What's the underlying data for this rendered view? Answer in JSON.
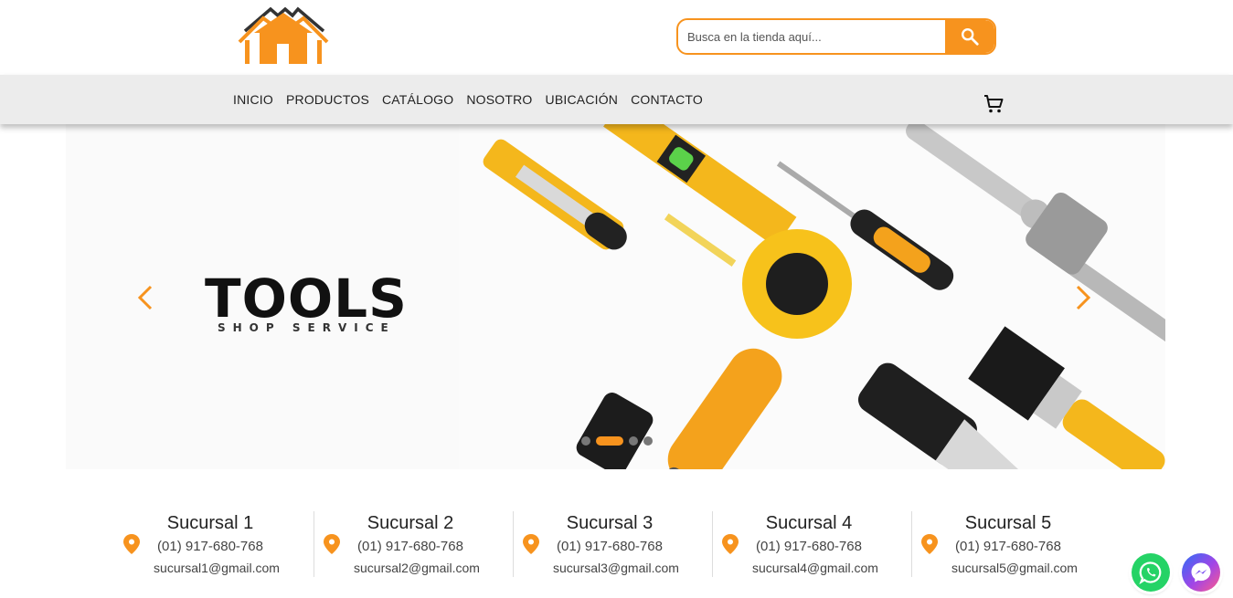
{
  "header": {
    "logo_icon": "house-logo-icon",
    "search": {
      "placeholder": "Busca en la tienda aquí...",
      "icon": "search-icon"
    }
  },
  "nav": {
    "items": [
      {
        "label": "INICIO"
      },
      {
        "label": "PRODUCTOS"
      },
      {
        "label": "CATÁLOGO"
      },
      {
        "label": "NOSOTRO"
      },
      {
        "label": "UBICACIÓN"
      },
      {
        "label": "CONTACTO"
      }
    ],
    "cart_icon": "cart-icon"
  },
  "hero": {
    "brand_title": "TOOLS",
    "brand_subtitle": "SHOP SERVICE",
    "slide_count": 4,
    "active_slide": 2
  },
  "branches": [
    {
      "name": "Sucursal 1",
      "phone": "(01) 917-680-768",
      "email": "sucursal1@gmail.com"
    },
    {
      "name": "Sucursal 2",
      "phone": "(01) 917-680-768",
      "email": "sucursal2@gmail.com"
    },
    {
      "name": "Sucursal 3",
      "phone": "(01) 917-680-768",
      "email": "sucursal3@gmail.com"
    },
    {
      "name": "Sucursal 4",
      "phone": "(01) 917-680-768",
      "email": "sucursal4@gmail.com"
    },
    {
      "name": "Sucursal 5",
      "phone": "(01) 917-680-768",
      "email": "sucursal5@gmail.com"
    }
  ],
  "floating": {
    "whatsapp_icon": "whatsapp-icon",
    "messenger_icon": "messenger-icon"
  },
  "colors": {
    "accent": "#f7931e",
    "nav_bg": "#ececec",
    "text": "#222222"
  }
}
